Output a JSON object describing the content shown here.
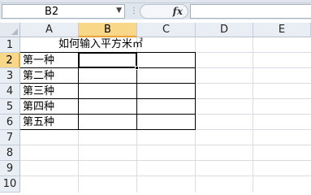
{
  "name_box": {
    "value": "B2"
  },
  "formula_bar": {
    "fx_label": "fx",
    "value": ""
  },
  "columns": [
    "A",
    "B",
    "C",
    "D",
    "E"
  ],
  "rows": [
    "1",
    "2",
    "3",
    "4",
    "5",
    "6",
    "7",
    "8",
    "9",
    "10"
  ],
  "selected": {
    "column": "B",
    "row": "2"
  },
  "cells": {
    "title": "如何输入平方米㎡",
    "a2": "第一种",
    "a3": "第二种",
    "a4": "第三种",
    "a5": "第四种",
    "a6": "第五种"
  }
}
